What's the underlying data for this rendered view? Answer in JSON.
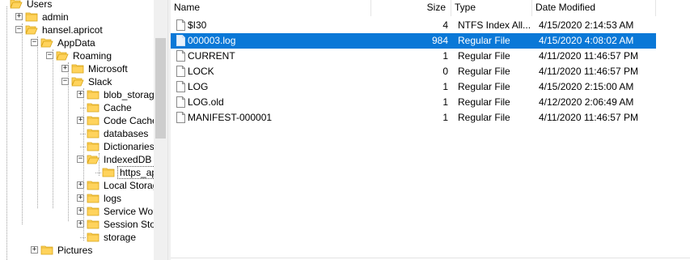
{
  "tree": {
    "items": [
      {
        "label": "Users",
        "expander": "",
        "name": "tree-item-users",
        "open": true
      },
      {
        "label": "admin",
        "expander": "+",
        "name": "tree-item-admin",
        "open": false
      },
      {
        "label": "hansel.apricot",
        "expander": "−",
        "name": "tree-item-hansel-apricot",
        "open": true
      },
      {
        "label": "AppData",
        "expander": "−",
        "name": "tree-item-appdata",
        "open": true
      },
      {
        "label": "Roaming",
        "expander": "−",
        "name": "tree-item-roaming",
        "open": true
      },
      {
        "label": "Microsoft",
        "expander": "+",
        "name": "tree-item-microsoft",
        "open": false
      },
      {
        "label": "Slack",
        "expander": "−",
        "name": "tree-item-slack",
        "open": true
      },
      {
        "label": "blob_storage",
        "expander": "+",
        "name": "tree-item-blob-storage",
        "open": false
      },
      {
        "label": "Cache",
        "expander": "",
        "name": "tree-item-cache",
        "open": false
      },
      {
        "label": "Code Cache",
        "expander": "+",
        "name": "tree-item-code-cache",
        "open": false
      },
      {
        "label": "databases",
        "expander": "",
        "name": "tree-item-databases",
        "open": false
      },
      {
        "label": "Dictionaries",
        "expander": "",
        "name": "tree-item-dictionaries",
        "open": false
      },
      {
        "label": "IndexedDB",
        "expander": "−",
        "name": "tree-item-indexeddb",
        "open": true
      },
      {
        "label": "https_app",
        "expander": "",
        "name": "tree-item-https-app",
        "open": false
      },
      {
        "label": "Local Storage",
        "expander": "+",
        "name": "tree-item-local-storage",
        "open": false
      },
      {
        "label": "logs",
        "expander": "+",
        "name": "tree-item-logs",
        "open": false
      },
      {
        "label": "Service Work",
        "expander": "+",
        "name": "tree-item-service-work",
        "open": false
      },
      {
        "label": "Session Stora",
        "expander": "+",
        "name": "tree-item-session-stora",
        "open": false
      },
      {
        "label": "storage",
        "expander": "",
        "name": "tree-item-storage",
        "open": false
      },
      {
        "label": "Pictures",
        "expander": "+",
        "name": "tree-item-pictures",
        "open": false
      }
    ]
  },
  "list": {
    "columns": {
      "name": "Name",
      "size": "Size",
      "type": "Type",
      "date": "Date Modified"
    },
    "rows": [
      {
        "name": "$I30",
        "size": "4",
        "type": "NTFS Index All...",
        "date": "4/15/2020 2:14:53 AM",
        "selected": false
      },
      {
        "name": "000003.log",
        "size": "984",
        "type": "Regular File",
        "date": "4/15/2020 4:08:02 AM",
        "selected": true
      },
      {
        "name": "CURRENT",
        "size": "1",
        "type": "Regular File",
        "date": "4/11/2020 11:46:57 PM",
        "selected": false
      },
      {
        "name": "LOCK",
        "size": "0",
        "type": "Regular File",
        "date": "4/11/2020 11:46:57 PM",
        "selected": false
      },
      {
        "name": "LOG",
        "size": "1",
        "type": "Regular File",
        "date": "4/15/2020 2:15:00 AM",
        "selected": false
      },
      {
        "name": "LOG.old",
        "size": "1",
        "type": "Regular File",
        "date": "4/12/2020 2:06:49 AM",
        "selected": false
      },
      {
        "name": "MANIFEST-000001",
        "size": "1",
        "type": "Regular File",
        "date": "4/11/2020 11:46:57 PM",
        "selected": false
      }
    ]
  },
  "colors": {
    "selection": "#0a78d7",
    "folder_fill": "#ffd35c",
    "folder_edge": "#d9a518"
  }
}
